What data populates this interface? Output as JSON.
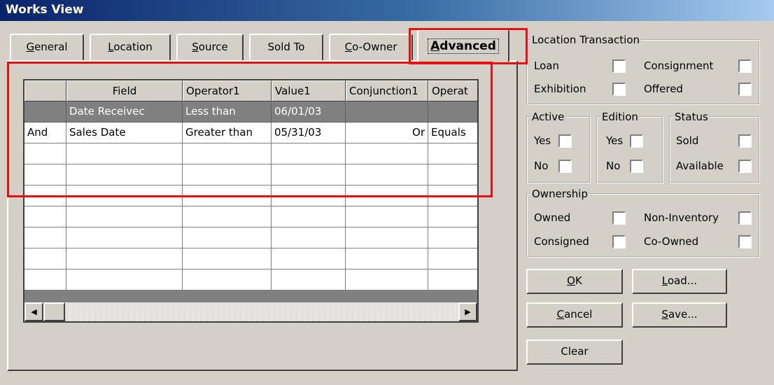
{
  "window": {
    "title": "Works View"
  },
  "tabs": [
    {
      "mnemonic": "G",
      "rest": "eneral"
    },
    {
      "mnemonic": "L",
      "rest": "ocation"
    },
    {
      "mnemonic": "S",
      "rest": "ource"
    },
    {
      "mnemonic": "",
      "rest": "Sold To"
    },
    {
      "mnemonic": "C",
      "rest": "o-Owner"
    },
    {
      "mnemonic": "A",
      "rest": "dvanced"
    }
  ],
  "active_tab": "Advanced",
  "grid": {
    "columns": [
      "",
      "Field",
      "Operator1",
      "Value1",
      "Conjunction1",
      "Operat"
    ],
    "rows": [
      [
        "",
        "Date Receivec",
        "Less than",
        "06/01/03",
        "",
        ""
      ],
      [
        "And",
        "Sales Date",
        "Greater than",
        "05/31/03",
        "Or",
        "Equals"
      ],
      [
        "",
        "",
        "",
        "",
        "",
        ""
      ],
      [
        "",
        "",
        "",
        "",
        "",
        ""
      ],
      [
        "",
        "",
        "",
        "",
        "",
        ""
      ],
      [
        "",
        "",
        "",
        "",
        "",
        ""
      ],
      [
        "",
        "",
        "",
        "",
        "",
        ""
      ],
      [
        "",
        "",
        "",
        "",
        "",
        ""
      ],
      [
        "",
        "",
        "",
        "",
        "",
        ""
      ]
    ],
    "selected_row": 0
  },
  "location_transaction": {
    "title": "Location Transaction",
    "loan": "Loan",
    "consignment": "Consignment",
    "exhibition": "Exhibition",
    "offered": "Offered"
  },
  "active_group": {
    "title": "Active",
    "yes": "Yes",
    "no": "No"
  },
  "edition_group": {
    "title": "Edition",
    "yes": "Yes",
    "no": "No"
  },
  "status_group": {
    "title": "Status",
    "sold": "Sold",
    "available": "Available"
  },
  "ownership": {
    "title": "Ownership",
    "owned": "Owned",
    "non_inventory": "Non-Inventory",
    "consigned": "Consigned",
    "co_owned": "Co-Owned"
  },
  "buttons": {
    "ok": {
      "mnemonic": "O",
      "rest": "K"
    },
    "load": {
      "mnemonic": "L",
      "rest": "oad..."
    },
    "cancel": {
      "mnemonic": "C",
      "rest": "ancel"
    },
    "save": {
      "mnemonic": "S",
      "rest": "ave..."
    },
    "clear": {
      "mnemonic": "",
      "rest": "Clear"
    }
  },
  "scrollbar": {
    "left_arrow": "◀",
    "right_arrow": "▶"
  },
  "colors": {
    "highlight_box": "#e81010",
    "selected_row": "#808080",
    "titlebar": "#0a246a"
  }
}
